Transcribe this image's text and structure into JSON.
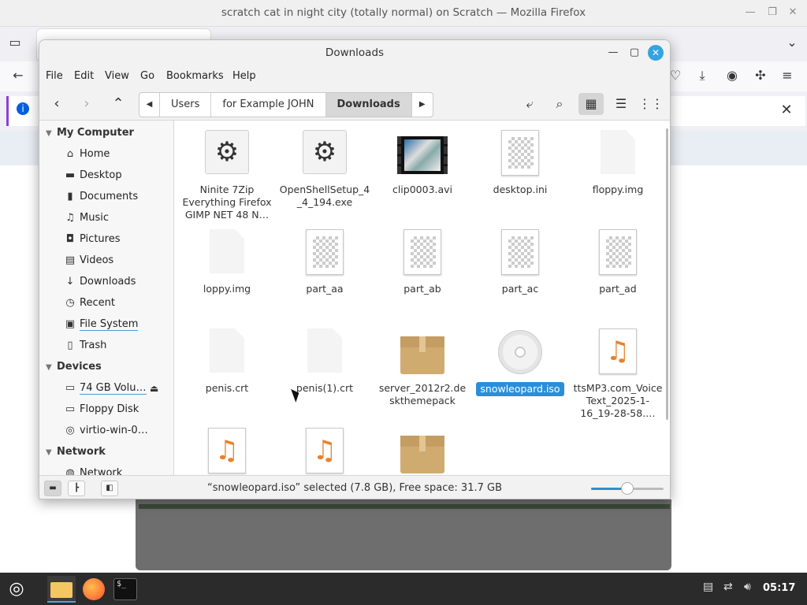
{
  "firefox": {
    "title": "scratch cat in night city (totally normal) on Scratch — Mozilla Firefox"
  },
  "window": {
    "title": "Downloads"
  },
  "menu": [
    "File",
    "Edit",
    "View",
    "Go",
    "Bookmarks",
    "Help"
  ],
  "breadcrumb": [
    "Users",
    "for Example JOHN",
    "Downloads"
  ],
  "sidebar": {
    "sections": [
      {
        "title": "My Computer",
        "items": [
          {
            "label": "Home",
            "icon": "home-icon"
          },
          {
            "label": "Desktop",
            "icon": "desktop-icon"
          },
          {
            "label": "Documents",
            "icon": "documents-icon"
          },
          {
            "label": "Music",
            "icon": "music-icon"
          },
          {
            "label": "Pictures",
            "icon": "pictures-icon"
          },
          {
            "label": "Videos",
            "icon": "videos-icon"
          },
          {
            "label": "Downloads",
            "icon": "downloads-icon"
          },
          {
            "label": "Recent",
            "icon": "recent-icon"
          },
          {
            "label": "File System",
            "icon": "filesystem-icon"
          },
          {
            "label": "Trash",
            "icon": "trash-icon"
          }
        ]
      },
      {
        "title": "Devices",
        "items": [
          {
            "label": "74 GB Volu…",
            "icon": "drive-icon"
          },
          {
            "label": "Floppy Disk",
            "icon": "floppy-icon"
          },
          {
            "label": "virtio-win-0…",
            "icon": "disc-icon"
          }
        ]
      },
      {
        "title": "Network",
        "items": [
          {
            "label": "Network",
            "icon": "network-icon"
          }
        ]
      }
    ]
  },
  "files": [
    {
      "name": "Ninite 7Zip Everything Firefox GIMP NET 48 N…",
      "type": "exe"
    },
    {
      "name": "OpenShellSetup_4_4_194.exe",
      "type": "exe"
    },
    {
      "name": "clip0003.avi",
      "type": "video"
    },
    {
      "name": "desktop.ini",
      "type": "doc"
    },
    {
      "name": "floppy.img",
      "type": "blank"
    },
    {
      "name": "loppy.img",
      "type": "blank"
    },
    {
      "name": "part_aa",
      "type": "doc"
    },
    {
      "name": "part_ab",
      "type": "doc"
    },
    {
      "name": "part_ac",
      "type": "doc"
    },
    {
      "name": "part_ad",
      "type": "doc"
    },
    {
      "name": "penis.crt",
      "type": "blank"
    },
    {
      "name": "penis(1).crt",
      "type": "blank"
    },
    {
      "name": "server_2012r2.deskthemepack",
      "type": "box"
    },
    {
      "name": "snowleopard.iso",
      "type": "disc",
      "selected": true
    },
    {
      "name": "ttsMP3.com_VoiceText_2025-1-16_19-28-58.…",
      "type": "music"
    },
    {
      "name": "",
      "type": "music"
    },
    {
      "name": "",
      "type": "music"
    },
    {
      "name": "",
      "type": "box"
    }
  ],
  "status": {
    "text": "“snowleopard.iso” selected (7.8 GB), Free space: 31.7 GB",
    "zoom_fraction": 0.5
  },
  "taskbar": {
    "clock": "05:17"
  },
  "colors": {
    "accent": "#2a8fd8",
    "close": "#35a3e0"
  }
}
